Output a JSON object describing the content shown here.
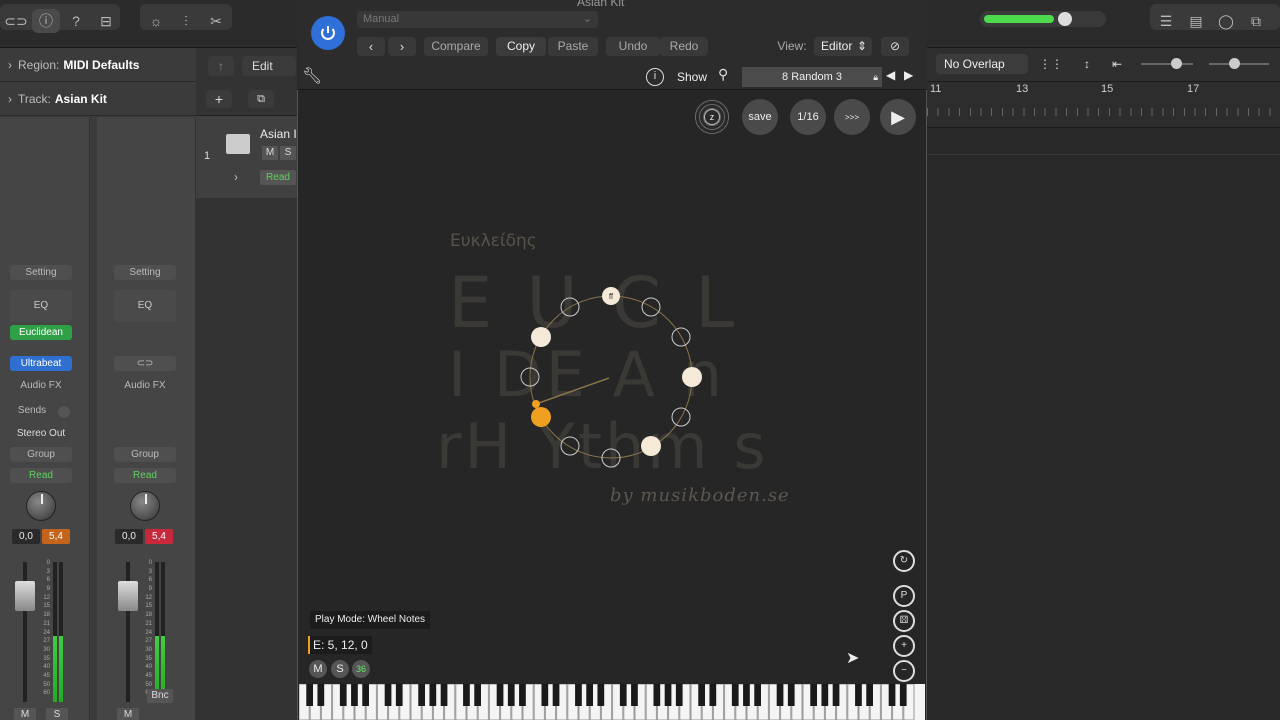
{
  "plugin": {
    "window_title": "Asian Kit",
    "preset_mode": "Manual",
    "compare": "Compare",
    "copy": "Copy",
    "paste": "Paste",
    "undo": "Undo",
    "redo": "Redo",
    "view_label": "View:",
    "view_value": "Editor",
    "show": "Show",
    "preset_name": "8 Random 3",
    "z_label": "z",
    "save": "save",
    "division": "1/16",
    "forward": ">>>",
    "greek_title": "Ευκλείδης",
    "ghost_line1": "E U C L",
    "ghost_line2": "I DE A n",
    "ghost_line3": "rH Ythm s",
    "byline": "by musikboden.se",
    "wheel_top_label": "ff",
    "play_mode": "Play Mode: Wheel Notes",
    "euclid_params": "E: 5, 12, 0",
    "mute": "M",
    "solo": "S",
    "note_number": "36",
    "side_icons": [
      "loop-icon",
      "p-pentagon-icon",
      "dice-icon",
      "plus-icon",
      "minus-icon"
    ]
  },
  "inspector": {
    "region_label": "Region:",
    "region_value": "MIDI Defaults",
    "track_label": "Track:",
    "track_value": "Asian Kit",
    "strip1": {
      "setting": "Setting",
      "eq": "EQ",
      "plugin": "Euclidean",
      "instrument": "Ultrabeat",
      "audio_fx": "Audio FX",
      "sends": "Sends",
      "output": "Stereo Out",
      "group": "Group",
      "read": "Read",
      "pan_val": "0,0",
      "peak_val": "5,4",
      "mute": "M",
      "solo": "S"
    },
    "strip2": {
      "setting": "Setting",
      "eq": "EQ",
      "audio_fx": "Audio FX",
      "group": "Group",
      "read": "Read",
      "pan_val": "0,0",
      "peak_val": "5,4",
      "name": "Bnc",
      "mute": "M"
    },
    "meter_scale": [
      "0",
      "3",
      "6",
      "9",
      "12",
      "15",
      "18",
      "21",
      "24",
      "27",
      "30",
      "35",
      "40",
      "45",
      "50",
      "60"
    ]
  },
  "tracks": {
    "edit_menu": "Edit",
    "track_number": "1",
    "track_name": "Asian I",
    "mute": "M",
    "solo": "S",
    "read": "Read"
  },
  "arrange": {
    "overlap_label": "No Overlap",
    "ruler": [
      "11",
      "13",
      "15",
      "17"
    ]
  },
  "colors": {
    "accent_orange": "#f0a020",
    "note_cream": "#f5ead8",
    "power_blue": "#2f6fd8",
    "green_meter": "#44cc44"
  }
}
